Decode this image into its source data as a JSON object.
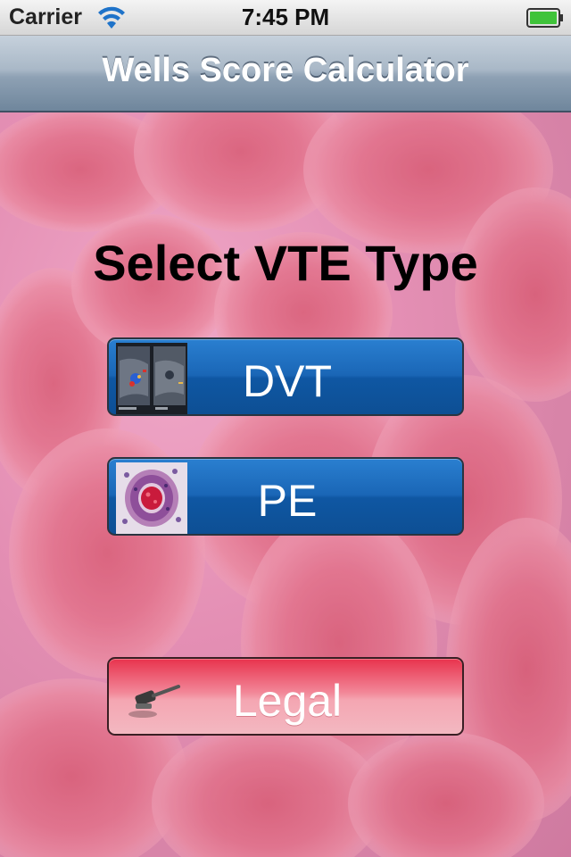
{
  "status_bar": {
    "carrier": "Carrier",
    "time": "7:45 PM"
  },
  "nav": {
    "title": "Wells Score Calculator"
  },
  "main": {
    "heading": "Select VTE Type",
    "buttons": [
      {
        "label": "DVT",
        "icon": "ultrasound-thumbnail-icon"
      },
      {
        "label": "PE",
        "icon": "histology-thumbnail-icon"
      }
    ],
    "legal": {
      "label": "Legal",
      "icon": "gavel-icon"
    }
  },
  "colors": {
    "nav_bar": "#8ea1b4",
    "primary_button": "#1a66b6",
    "legal_button": "#e8334d",
    "background": "#e48fb4"
  }
}
